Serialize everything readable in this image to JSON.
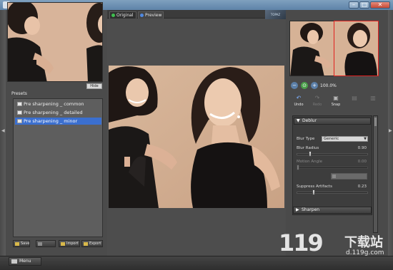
{
  "window": {
    "title": "",
    "min_glyph": "–",
    "max_glyph": "□",
    "close_glyph": "✕"
  },
  "left_panel": {
    "hide_label": "Hide",
    "presets_label": "Presets",
    "presets": [
      {
        "label": "Pre sharpening _ common",
        "selected": false
      },
      {
        "label": "Pre sharpening _ detailed",
        "selected": false
      },
      {
        "label": "Pre sharpening _ minor",
        "selected": true
      }
    ],
    "toolbar": {
      "save_label": "Save",
      "import_label": "Import",
      "export_label": "Export"
    }
  },
  "center": {
    "tabs": [
      {
        "label": "Original",
        "active": true
      },
      {
        "label": "Preview",
        "active": false
      }
    ],
    "logo_text": "TOPAZ"
  },
  "right_panel": {
    "zoom_value": "100.0%",
    "toolbar": [
      {
        "label": "Undo",
        "enabled": true
      },
      {
        "label": "Redo",
        "enabled": false
      },
      {
        "label": "Snap",
        "enabled": true
      },
      {
        "label": "",
        "enabled": false
      },
      {
        "label": "",
        "enabled": false
      }
    ],
    "deblur": {
      "header": "Deblur",
      "blur_type_label": "Blur Type",
      "blur_type_value": "Generic",
      "blur_radius_label": "Blur Radius",
      "blur_radius_value": "0.90",
      "blur_radius_fraction": 0.18,
      "motion_angle_label": "Motion Angle",
      "motion_angle_value": "0.00",
      "motion_angle_fraction": 0.0,
      "suppress_label": "Suppress Artifacts",
      "suppress_value": "0.23",
      "suppress_fraction": 0.23
    },
    "sharpen_header": "Sharpen"
  },
  "bottom": {
    "menu_label": "Menu"
  },
  "watermark": {
    "text": "下载站",
    "url": "d.119g.com"
  },
  "colors": {
    "selection": "#3b6fcf",
    "navigator_box": "#e0201f",
    "accent": "#7db0ff"
  }
}
